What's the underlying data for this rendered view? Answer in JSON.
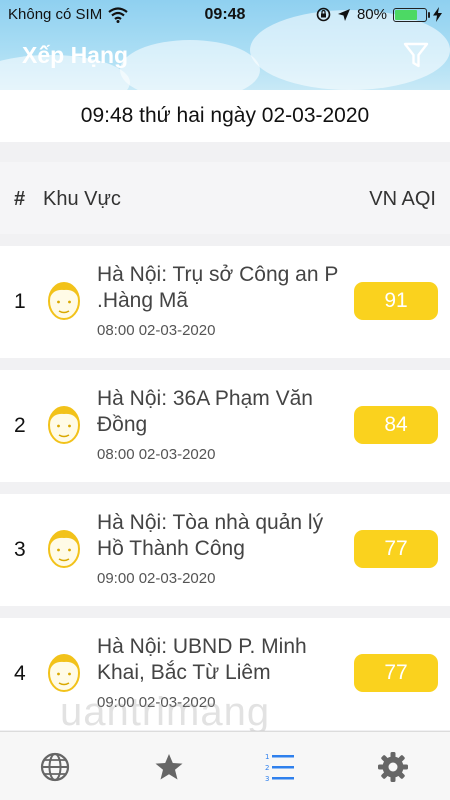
{
  "status_bar": {
    "carrier": "Không có SIM",
    "time": "09:48",
    "battery": "80%",
    "battery_level": 0.8
  },
  "header": {
    "title": "Xếp Hạng"
  },
  "date_line": "09:48 thứ hai ngày 02-03-2020",
  "table_header": {
    "rank": "#",
    "area": "Khu Vực",
    "aqi": "VN AQI"
  },
  "rows": [
    {
      "rank": "1",
      "name": "Hà Nội: Trụ sở Công an P .Hàng Mã",
      "time": "08:00 02-03-2020",
      "aqi": "91"
    },
    {
      "rank": "2",
      "name": "Hà Nội: 36A Phạm Văn Đồng",
      "time": "08:00 02-03-2020",
      "aqi": "84"
    },
    {
      "rank": "3",
      "name": "Hà Nội: Tòa nhà quản lý Hồ Thành Công",
      "time": "09:00 02-03-2020",
      "aqi": "77"
    },
    {
      "rank": "4",
      "name": "Hà Nội: UBND P. Minh Khai, Bắc Từ Liêm",
      "time": "09:00 02-03-2020",
      "aqi": "77"
    }
  ],
  "colors": {
    "badge": "#fad21e",
    "sky": "#a9ddf4",
    "icon": "#666666"
  },
  "tabs": [
    "globe-icon",
    "star-icon",
    "ranking-list-icon",
    "gear-icon"
  ],
  "watermark": "uantrimang"
}
